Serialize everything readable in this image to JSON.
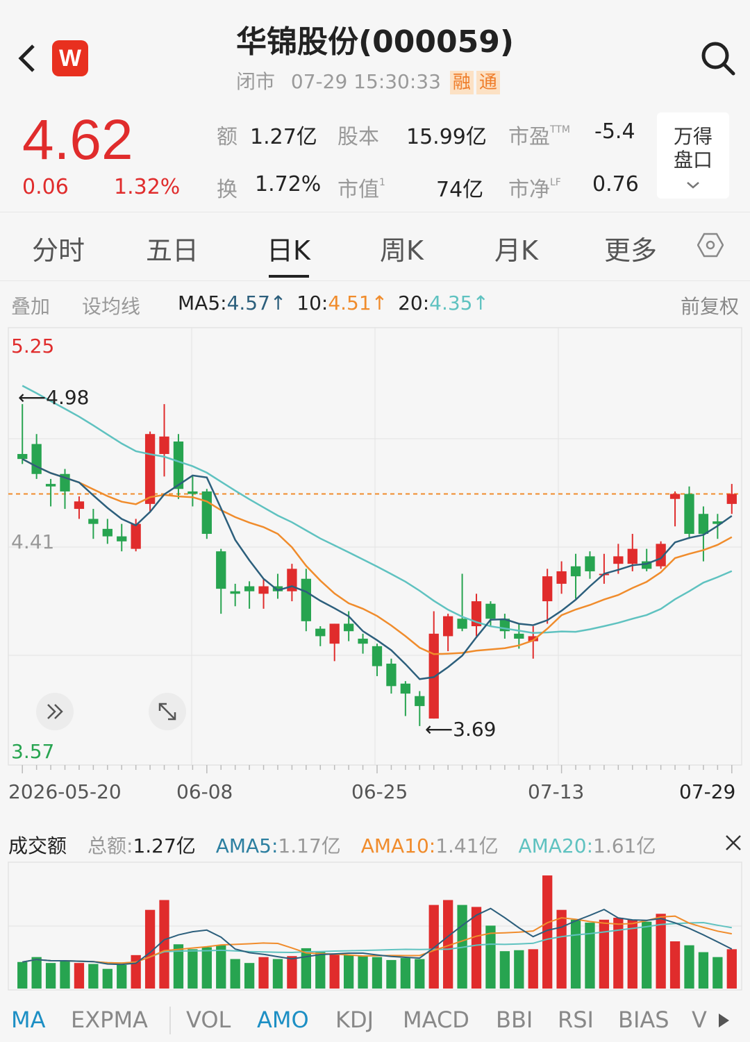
{
  "header": {
    "back_icon": "chevron-left-icon",
    "app_logo": "W",
    "title": "华锦股份(000059)",
    "status": "闭市",
    "datetime": "07-29 15:30:33",
    "tag_rong": "融",
    "tag_tong": "通",
    "search_icon": "search-icon"
  },
  "quote": {
    "price": "4.62",
    "change": "0.06",
    "change_pct": "1.32%",
    "stats": [
      {
        "label": "额",
        "value": "1.27亿"
      },
      {
        "label": "股本",
        "value": "15.99亿"
      },
      {
        "label": "市盈",
        "sup": "TTM",
        "value": "-5.4"
      },
      {
        "label": "换",
        "value": "1.72%"
      },
      {
        "label": "市值",
        "sup": "1",
        "value": "74亿"
      },
      {
        "label": "市净",
        "sup": "LF",
        "value": "0.76"
      }
    ],
    "wande_line1": "万得",
    "wande_line2": "盘口"
  },
  "tabs": [
    "分时",
    "五日",
    "日K",
    "周K",
    "月K",
    "更多"
  ],
  "active_tab": "日K",
  "toolbar": {
    "overlay": "叠加",
    "set_ma": "设均线",
    "ma5_label": "MA5:",
    "ma5_value": "4.57",
    "ma10_label": "10:",
    "ma10_value": "4.51",
    "ma20_label": "20:",
    "ma20_value": "4.35",
    "adjust": "前复权"
  },
  "kline": {
    "y_labels": {
      "top": "5.25",
      "mid": "4.41",
      "bottom": "3.57"
    },
    "annotations": {
      "high": "4.98",
      "low": "3.69"
    },
    "x_labels": [
      "2026-05-20",
      "06-08",
      "06-25",
      "07-13",
      "07-29"
    ],
    "colors": {
      "up": "#e02c2c",
      "down": "#27a450",
      "ma5": "#2c5f7c",
      "ma10": "#f08c2c",
      "ma20": "#5fc2c0",
      "ref": "#f08c2c"
    }
  },
  "volume": {
    "title": "成交额",
    "total_label": "总额:",
    "total_value": "1.27亿",
    "ama5_label": "AMA5:",
    "ama5_value": "1.17亿",
    "ama10_label": "AMA10:",
    "ama10_value": "1.41亿",
    "ama20_label": "AMA20:",
    "ama20_value": "1.61亿"
  },
  "bottom_tabs": [
    "MA",
    "EXPMA",
    "VOL",
    "AMO",
    "KDJ",
    "MACD",
    "BBI",
    "RSI",
    "BIAS",
    "V"
  ],
  "chart_data": {
    "type": "candlestick",
    "title": "",
    "ylim": [
      3.57,
      5.25
    ],
    "reference_line": 4.62,
    "candles": [
      {
        "o": 4.78,
        "h": 4.98,
        "l": 4.74,
        "c": 4.76
      },
      {
        "o": 4.82,
        "h": 4.86,
        "l": 4.68,
        "c": 4.7
      },
      {
        "o": 4.66,
        "h": 4.68,
        "l": 4.57,
        "c": 4.65
      },
      {
        "o": 4.7,
        "h": 4.72,
        "l": 4.56,
        "c": 4.63
      },
      {
        "o": 4.56,
        "h": 4.61,
        "l": 4.52,
        "c": 4.59
      },
      {
        "o": 4.52,
        "h": 4.56,
        "l": 4.44,
        "c": 4.5
      },
      {
        "o": 4.48,
        "h": 4.52,
        "l": 4.42,
        "c": 4.45
      },
      {
        "o": 4.45,
        "h": 4.5,
        "l": 4.39,
        "c": 4.43
      },
      {
        "o": 4.4,
        "h": 4.52,
        "l": 4.39,
        "c": 4.5
      },
      {
        "o": 4.58,
        "h": 4.87,
        "l": 4.55,
        "c": 4.86
      },
      {
        "o": 4.78,
        "h": 4.98,
        "l": 4.69,
        "c": 4.85
      },
      {
        "o": 4.83,
        "h": 4.86,
        "l": 4.6,
        "c": 4.64
      },
      {
        "o": 4.63,
        "h": 4.69,
        "l": 4.57,
        "c": 4.62
      },
      {
        "o": 4.63,
        "h": 4.64,
        "l": 4.44,
        "c": 4.46
      },
      {
        "o": 4.39,
        "h": 4.4,
        "l": 4.14,
        "c": 4.24
      },
      {
        "o": 4.23,
        "h": 4.26,
        "l": 4.17,
        "c": 4.22
      },
      {
        "o": 4.25,
        "h": 4.27,
        "l": 4.16,
        "c": 4.23
      },
      {
        "o": 4.22,
        "h": 4.28,
        "l": 4.16,
        "c": 4.25
      },
      {
        "o": 4.25,
        "h": 4.3,
        "l": 4.2,
        "c": 4.23
      },
      {
        "o": 4.23,
        "h": 4.34,
        "l": 4.19,
        "c": 4.32
      },
      {
        "o": 4.28,
        "h": 4.32,
        "l": 4.07,
        "c": 4.11
      },
      {
        "o": 4.08,
        "h": 4.09,
        "l": 4.01,
        "c": 4.05
      },
      {
        "o": 4.02,
        "h": 4.1,
        "l": 3.95,
        "c": 4.1
      },
      {
        "o": 4.1,
        "h": 4.15,
        "l": 4.03,
        "c": 4.07
      },
      {
        "o": 4.04,
        "h": 4.06,
        "l": 3.98,
        "c": 4.02
      },
      {
        "o": 4.01,
        "h": 4.02,
        "l": 3.89,
        "c": 3.93
      },
      {
        "o": 3.94,
        "h": 3.96,
        "l": 3.82,
        "c": 3.85
      },
      {
        "o": 3.86,
        "h": 3.87,
        "l": 3.73,
        "c": 3.82
      },
      {
        "o": 3.81,
        "h": 3.83,
        "l": 3.69,
        "c": 3.77
      },
      {
        "o": 3.72,
        "h": 4.15,
        "l": 3.72,
        "c": 4.06
      },
      {
        "o": 4.05,
        "h": 4.14,
        "l": 3.99,
        "c": 4.13
      },
      {
        "o": 4.12,
        "h": 4.3,
        "l": 4.07,
        "c": 4.08
      },
      {
        "o": 4.09,
        "h": 4.22,
        "l": 4.05,
        "c": 4.19
      },
      {
        "o": 4.18,
        "h": 4.19,
        "l": 4.09,
        "c": 4.12
      },
      {
        "o": 4.12,
        "h": 4.14,
        "l": 4.04,
        "c": 4.07
      },
      {
        "o": 4.06,
        "h": 4.1,
        "l": 4.0,
        "c": 4.04
      },
      {
        "o": 4.03,
        "h": 4.09,
        "l": 3.96,
        "c": 4.05
      },
      {
        "o": 4.19,
        "h": 4.32,
        "l": 4.1,
        "c": 4.29
      },
      {
        "o": 4.26,
        "h": 4.35,
        "l": 4.22,
        "c": 4.31
      },
      {
        "o": 4.33,
        "h": 4.38,
        "l": 4.2,
        "c": 4.29
      },
      {
        "o": 4.37,
        "h": 4.39,
        "l": 4.28,
        "c": 4.31
      },
      {
        "o": 4.3,
        "h": 4.38,
        "l": 4.26,
        "c": 4.3
      },
      {
        "o": 4.34,
        "h": 4.42,
        "l": 4.3,
        "c": 4.37
      },
      {
        "o": 4.34,
        "h": 4.46,
        "l": 4.31,
        "c": 4.4
      },
      {
        "o": 4.35,
        "h": 4.4,
        "l": 4.31,
        "c": 4.32
      },
      {
        "o": 4.33,
        "h": 4.43,
        "l": 4.32,
        "c": 4.42
      },
      {
        "o": 4.6,
        "h": 4.63,
        "l": 4.49,
        "c": 4.62
      },
      {
        "o": 4.62,
        "h": 4.65,
        "l": 4.44,
        "c": 4.46
      },
      {
        "o": 4.54,
        "h": 4.57,
        "l": 4.35,
        "c": 4.46
      },
      {
        "o": 4.51,
        "h": 4.54,
        "l": 4.44,
        "c": 4.5
      },
      {
        "o": 4.58,
        "h": 4.66,
        "l": 4.54,
        "c": 4.62
      }
    ],
    "amount": [
      0.87,
      0.92,
      0.86,
      0.88,
      0.86,
      0.85,
      0.8,
      0.84,
      0.94,
      1.4,
      1.5,
      1.05,
      1.0,
      1.02,
      1.04,
      0.9,
      0.86,
      0.92,
      0.9,
      0.93,
      1.01,
      0.97,
      0.95,
      0.94,
      0.93,
      0.92,
      0.89,
      0.91,
      0.9,
      1.45,
      1.5,
      1.45,
      1.43,
      1.24,
      0.98,
      0.99,
      1.0,
      1.75,
      1.4,
      1.3,
      1.27,
      1.3,
      1.32,
      1.3,
      1.28,
      1.36,
      1.08,
      1.04,
      0.97,
      0.92,
      1.0
    ],
    "ylim_amount": [
      0.6,
      1.8
    ]
  }
}
